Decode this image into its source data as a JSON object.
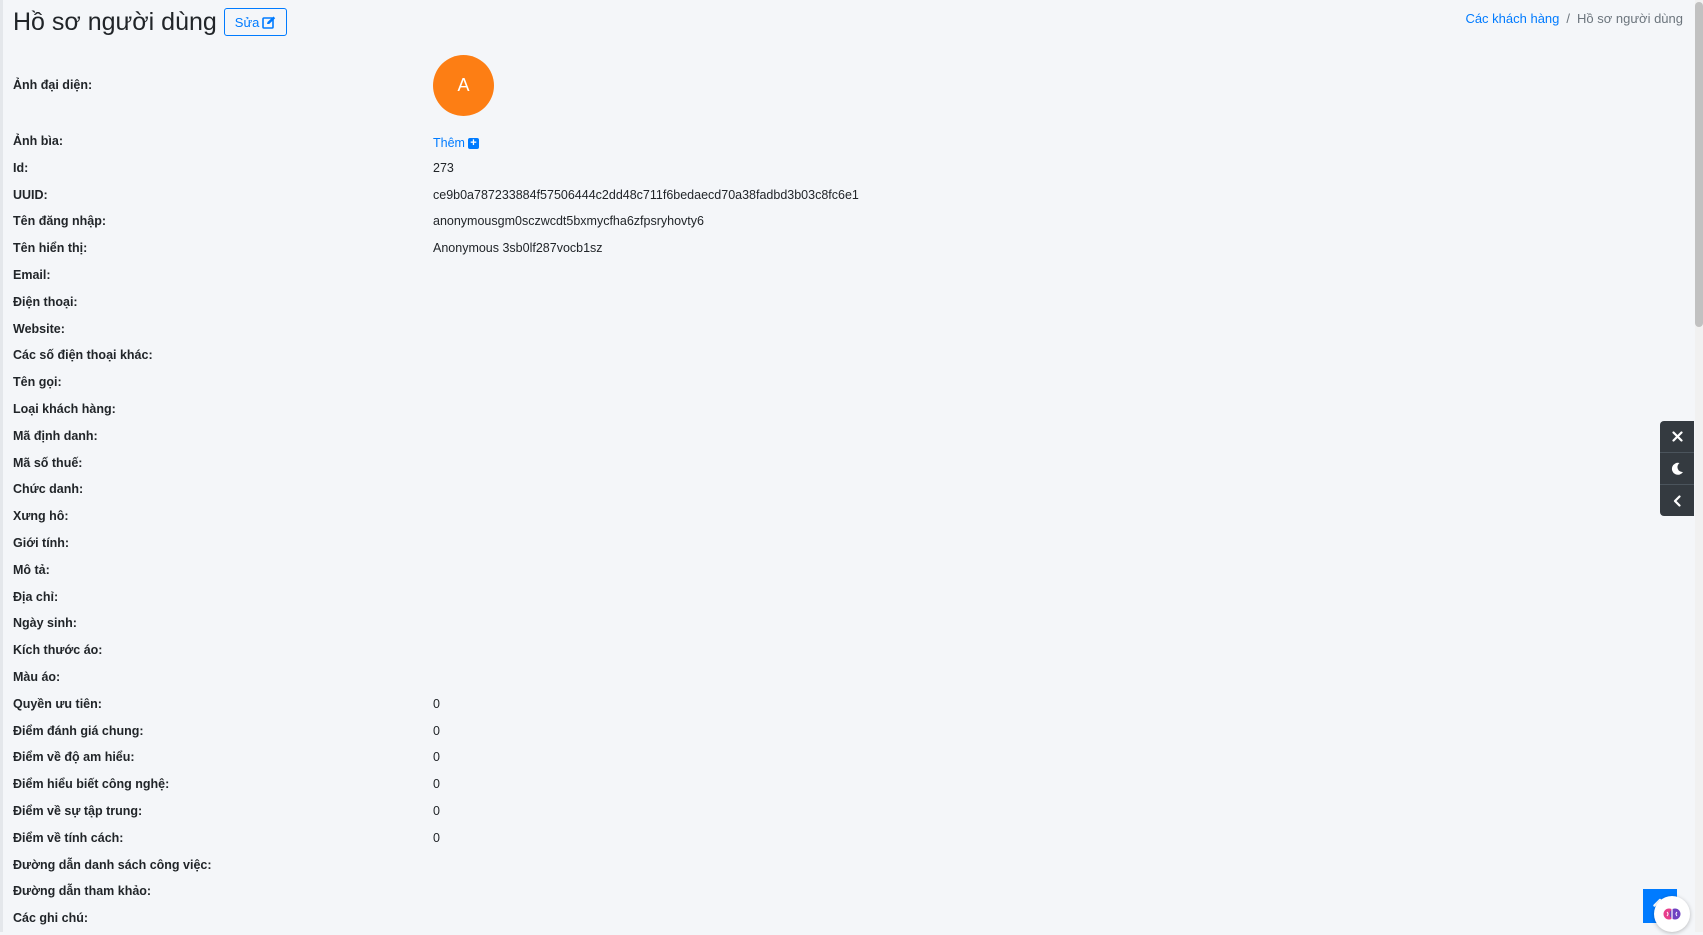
{
  "header": {
    "title": "Hồ sơ người dùng",
    "edit_label": "Sửa"
  },
  "breadcrumb": {
    "parent": "Các khách hàng",
    "separator": "/",
    "current": "Hồ sơ người dùng"
  },
  "profile": {
    "avatar_label": "Ảnh đại diện:",
    "avatar_initial": "A",
    "avatar_color": "#fd7e14",
    "cover_label": "Ảnh bìa:",
    "cover_add_label": "Thêm",
    "fields": [
      {
        "label": "Id:",
        "value": "273"
      },
      {
        "label": "UUID:",
        "value": "ce9b0a787233884f57506444c2dd48c711f6bedaecd70a38fadbd3b03c8fc6e1"
      },
      {
        "label": "Tên đăng nhập:",
        "value": "anonymousgm0sczwcdt5bxmycfha6zfpsryhovty6"
      },
      {
        "label": "Tên hiển thị:",
        "value": "Anonymous 3sb0lf287vocb1sz"
      },
      {
        "label": "Email:",
        "value": ""
      },
      {
        "label": "Điện thoại:",
        "value": ""
      },
      {
        "label": "Website:",
        "value": ""
      },
      {
        "label": "Các số điện thoại khác:",
        "value": ""
      },
      {
        "label": "Tên gọi:",
        "value": ""
      },
      {
        "label": "Loại khách hàng:",
        "value": ""
      },
      {
        "label": "Mã định danh:",
        "value": ""
      },
      {
        "label": "Mã số thuế:",
        "value": ""
      },
      {
        "label": "Chức danh:",
        "value": ""
      },
      {
        "label": "Xưng hô:",
        "value": ""
      },
      {
        "label": "Giới tính:",
        "value": ""
      },
      {
        "label": "Mô tả:",
        "value": ""
      },
      {
        "label": "Địa chỉ:",
        "value": ""
      },
      {
        "label": "Ngày sinh:",
        "value": ""
      },
      {
        "label": "Kích thước áo:",
        "value": ""
      },
      {
        "label": "Màu áo:",
        "value": ""
      },
      {
        "label": "Quyền ưu tiên:",
        "value": "0"
      },
      {
        "label": "Điểm đánh giá chung:",
        "value": "0"
      },
      {
        "label": "Điểm về độ am hiểu:",
        "value": "0"
      },
      {
        "label": "Điểm hiểu biết công nghệ:",
        "value": "0"
      },
      {
        "label": "Điểm về sự tập trung:",
        "value": "0"
      },
      {
        "label": "Điểm về tính cách:",
        "value": "0"
      },
      {
        "label": "Đường dẫn danh sách công việc:",
        "value": ""
      },
      {
        "label": "Đường dẫn tham khảo:",
        "value": ""
      },
      {
        "label": "Các ghi chú:",
        "value": ""
      }
    ]
  },
  "colors": {
    "accent": "#007bff",
    "background": "#f4f6f9",
    "tools_bg": "#343a40"
  },
  "icons": {
    "edit": "edit-icon",
    "plus": "plus-square-icon",
    "close": "close-icon",
    "moon": "moon-icon",
    "chevron": "chevron-left-icon",
    "arrow_up": "arrow-up-icon",
    "brain": "brain-icon"
  }
}
